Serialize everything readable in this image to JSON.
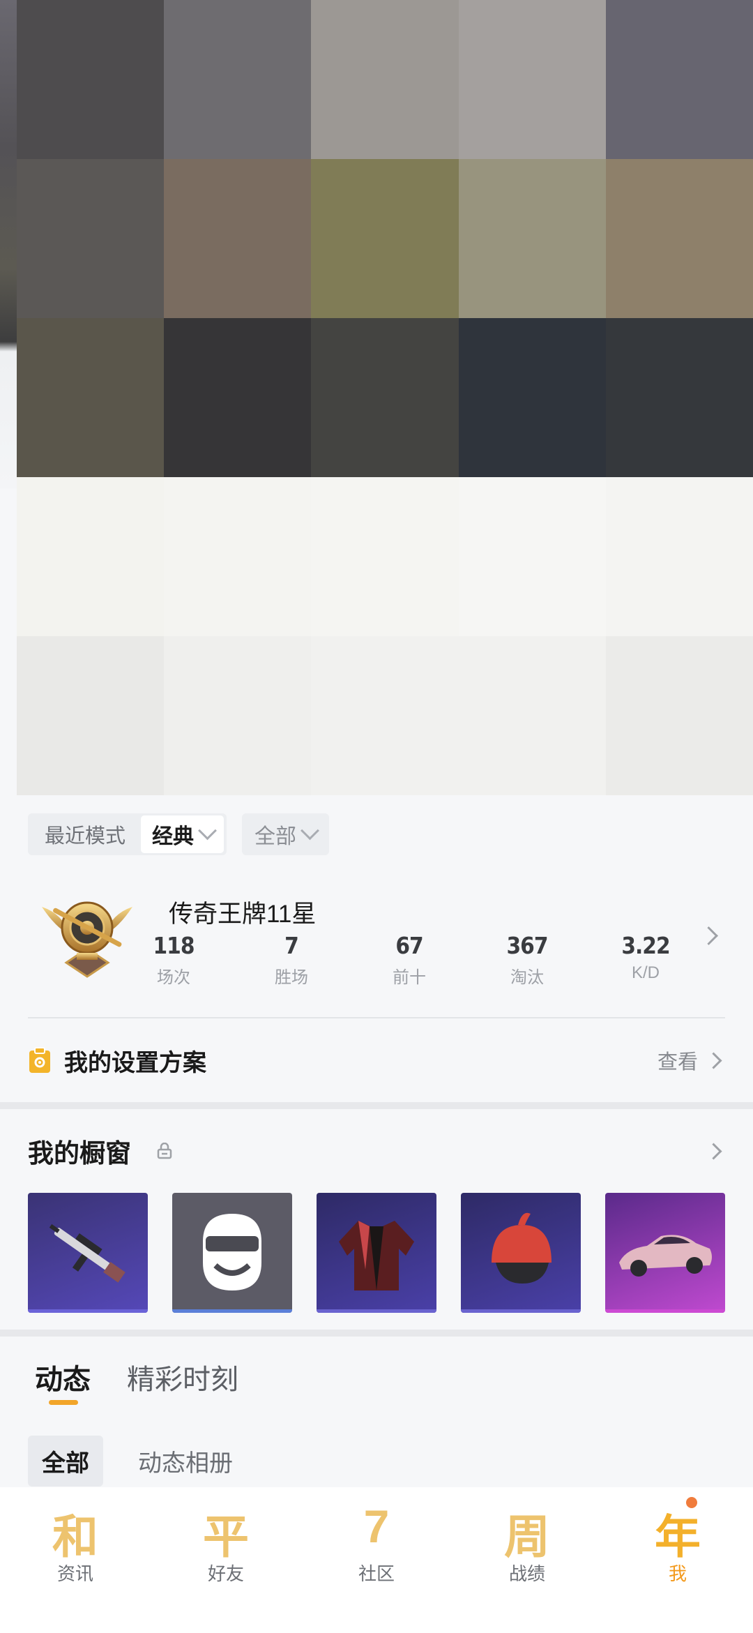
{
  "hero": {
    "mosaic": [
      "#4e4c4e",
      "#6e6c70",
      "#9c9894",
      "#a4a09e",
      "#676570",
      "#5b5856",
      "#7a6c60",
      "#807c56",
      "#98947e",
      "#8e806a",
      "#5a564b",
      "#363537",
      "#444441",
      "#2f343c",
      "#35383c",
      "#f3f3ef",
      "#f4f4f1",
      "#f5f5f2",
      "#f6f6f4",
      "#f4f4f2",
      "#e9e9e7",
      "#efefed",
      "#f1f1ef",
      "#f1f1ef",
      "#ebebe9"
    ]
  },
  "filters": {
    "recent_mode_label": "最近模式",
    "mode_value": "经典",
    "scope_value": "全部"
  },
  "rank": {
    "title": "传奇王牌11星",
    "stats": [
      {
        "value": "118",
        "label": "场次"
      },
      {
        "value": "7",
        "label": "胜场"
      },
      {
        "value": "67",
        "label": "前十"
      },
      {
        "value": "367",
        "label": "淘汰"
      },
      {
        "value": "3.22",
        "label": "K/D"
      }
    ]
  },
  "settings": {
    "title": "我的设置方案",
    "view_label": "查看"
  },
  "showcase": {
    "title": "我的橱窗",
    "items": [
      {
        "name": "rifle",
        "color": "#4a3fa0",
        "bar": "#6b63d8"
      },
      {
        "name": "helmet-mask",
        "color": "#5c5b66",
        "bar": "#5b7fd8"
      },
      {
        "name": "jacket",
        "color": "#3d357f",
        "bar": "#6a63cf"
      },
      {
        "name": "red-helmet",
        "color": "#3b3580",
        "bar": "#6a63cf"
      },
      {
        "name": "car",
        "color": "#8a3fb8",
        "bar": "#cc4ad3"
      }
    ]
  },
  "tabs": {
    "items": [
      "动态",
      "精彩时刻"
    ],
    "sub_items": [
      "全部",
      "动态相册"
    ]
  },
  "nav": {
    "items": [
      {
        "icon": "和",
        "label": "资讯"
      },
      {
        "icon": "平",
        "label": "好友"
      },
      {
        "icon": "7",
        "label": "社区"
      },
      {
        "icon": "周",
        "label": "战绩"
      },
      {
        "icon": "年",
        "label": "我"
      }
    ]
  }
}
